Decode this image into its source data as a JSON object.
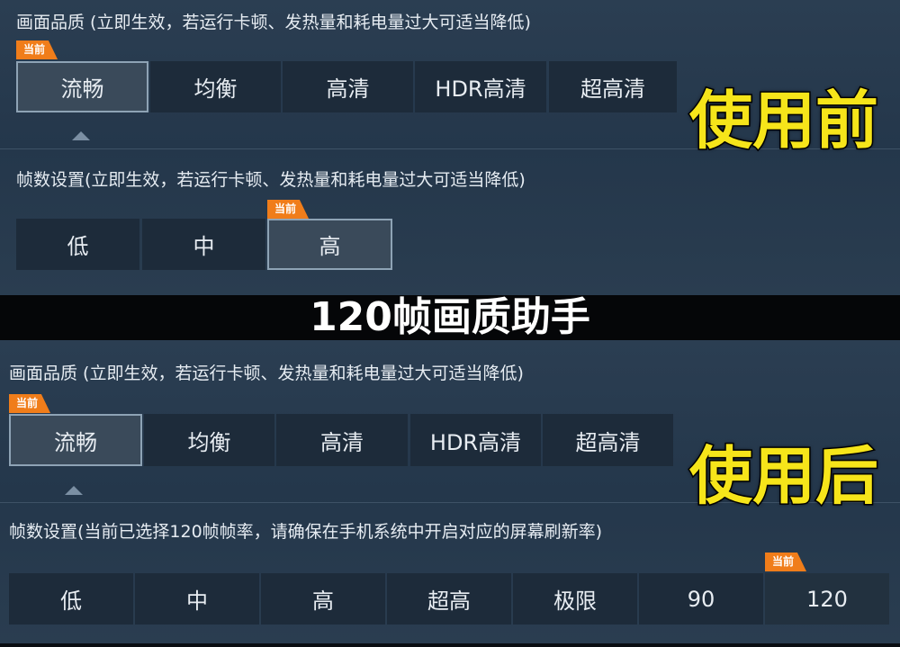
{
  "before": {
    "quality_title": "画面品质 (立即生效，若运行卡顿、发热量和耗电量过大可适当降低)",
    "quality_options": [
      "流畅",
      "均衡",
      "高清",
      "HDR高清",
      "超高清"
    ],
    "fps_title": "帧数设置(立即生效，若运行卡顿、发热量和耗电量过大可适当降低)",
    "fps_options": [
      "低",
      "中",
      "高"
    ],
    "current_badge": "当前",
    "label": "使用前"
  },
  "banner": "120帧画质助手",
  "after": {
    "quality_title": "画面品质 (立即生效，若运行卡顿、发热量和耗电量过大可适当降低)",
    "quality_options": [
      "流畅",
      "均衡",
      "高清",
      "HDR高清",
      "超高清"
    ],
    "fps_title": "帧数设置(当前已选择120帧帧率，请确保在手机系统中开启对应的屏幕刷新率)",
    "fps_options": [
      "低",
      "中",
      "高",
      "超高",
      "极限",
      "90",
      "120"
    ],
    "current_badge": "当前",
    "label": "使用后"
  },
  "colors": {
    "badge": "#f07d1a",
    "label": "#f6e51a"
  }
}
